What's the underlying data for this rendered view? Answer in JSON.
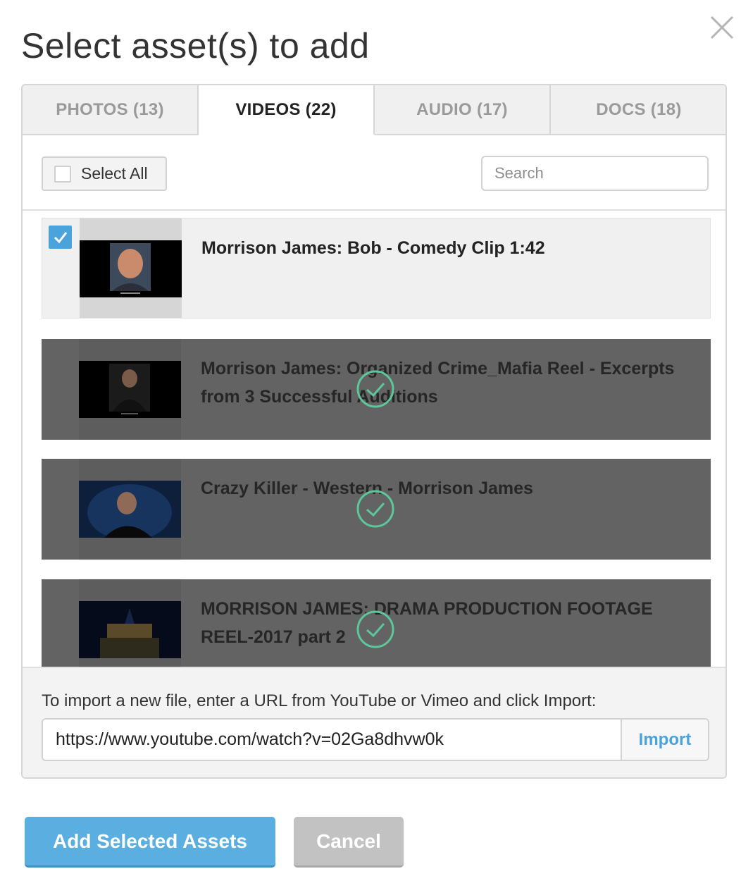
{
  "dialog": {
    "title": "Select asset(s) to add",
    "close_icon": "close-icon"
  },
  "tabs": [
    {
      "label": "PHOTOS (13)",
      "active": false
    },
    {
      "label": "VIDEOS (22)",
      "active": true
    },
    {
      "label": "AUDIO (17)",
      "active": false
    },
    {
      "label": "DOCS (18)",
      "active": false
    }
  ],
  "toolbar": {
    "select_all_label": "Select All",
    "select_all_checked": false,
    "search_placeholder": "Search",
    "search_value": ""
  },
  "videos": [
    {
      "title": "Morrison James: Bob - Comedy Clip 1:42",
      "state": "selected",
      "checked": true
    },
    {
      "title": "Morrison James: Organized Crime_Mafia Reel - Excerpts from 3 Successful Auditions",
      "state": "already-added",
      "checked": false
    },
    {
      "title": "Crazy Killer - Western - Morrison James",
      "state": "already-added",
      "checked": false
    },
    {
      "title": "MORRISON JAMES: DRAMA PRODUCTION FOOTAGE REEL-2017 part 2",
      "state": "already-added",
      "checked": false
    }
  ],
  "import": {
    "help_text": "To import a new file, enter a URL from YouTube or Vimeo and click Import:",
    "url_value": "https://www.youtube.com/watch?v=02Ga8dhvw0k",
    "button_label": "Import"
  },
  "footer": {
    "primary_label": "Add Selected Assets",
    "cancel_label": "Cancel"
  },
  "colors": {
    "accent": "#5aaee0",
    "checkbox": "#4ba3dc",
    "added_overlay": "#636363",
    "added_check": "#5cc79a",
    "cancel": "#c2c2c2"
  }
}
